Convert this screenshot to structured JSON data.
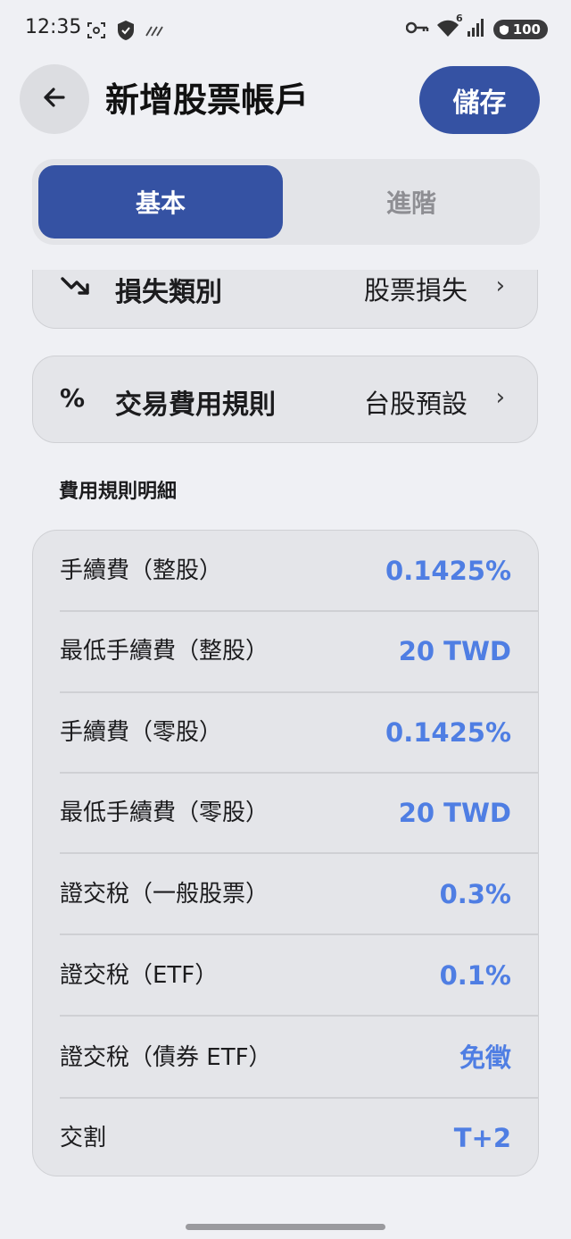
{
  "status_bar": {
    "time": "12:35",
    "battery": "100",
    "network_badge": "6",
    "icons": [
      "screenshot-icon",
      "shield-icon",
      "data-saver-icon",
      "key-icon",
      "wifi-icon",
      "signal-icon",
      "battery-icon"
    ]
  },
  "header": {
    "title": "新增股票帳戶",
    "save_label": "儲存"
  },
  "tabs": [
    {
      "label": "基本",
      "active": true
    },
    {
      "label": "進階",
      "active": false
    }
  ],
  "settings": {
    "loss": {
      "label": "損失類別",
      "value": "股票損失",
      "icon": "trending-down-icon"
    },
    "fee_rule": {
      "label": "交易費用規則",
      "value": "台股預設",
      "icon_glyph": "%"
    }
  },
  "details": {
    "title": "費用規則明細",
    "rows": [
      {
        "label": "手續費（整股）",
        "value": "0.1425%"
      },
      {
        "label": "最低手續費（整股）",
        "value": "20 TWD"
      },
      {
        "label": "手續費（零股）",
        "value": "0.1425%"
      },
      {
        "label": "最低手續費（零股）",
        "value": "20 TWD"
      },
      {
        "label": "證交稅（一般股票）",
        "value": "0.3%"
      },
      {
        "label": "證交稅（ETF）",
        "value": "0.1%"
      },
      {
        "label": "證交稅（債券 ETF）",
        "value": "免徵"
      },
      {
        "label": "交割",
        "value": "T+2"
      }
    ]
  },
  "colors": {
    "primary": "#3552a3",
    "value_blue": "#4f7ee3",
    "background": "#eff0f4",
    "card": "#e4e5e9"
  }
}
